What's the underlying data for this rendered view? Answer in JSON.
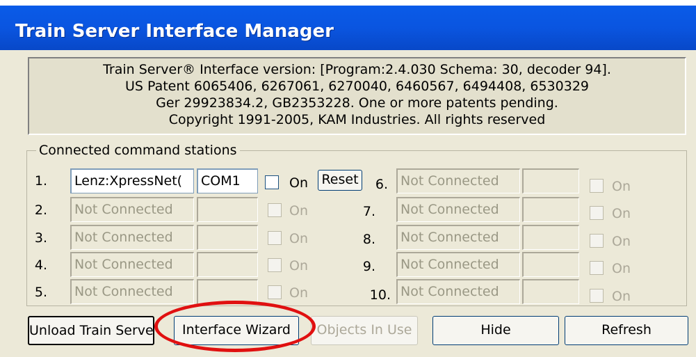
{
  "window": {
    "title": "Train Server Interface Manager"
  },
  "info": {
    "lines": [
      "Train Server® Interface version: [Program:2.4.030 Schema: 30, decoder 94].",
      "US Patent  6065406, 6267061, 6270040, 6460567, 6494408, 6530329",
      "Ger 29923834.2, GB2353228. One or more patents pending.",
      "Copyright 1991-2005, KAM Industries. All rights reserved"
    ]
  },
  "stations": {
    "group_label": "Connected command stations",
    "reset_label": "Reset",
    "on_label": "On",
    "left": [
      {
        "num": "1.",
        "name": "Lenz:XpressNet(",
        "port": "COM1"
      },
      {
        "num": "2.",
        "name": "Not Connected",
        "port": ""
      },
      {
        "num": "3.",
        "name": "Not Connected",
        "port": ""
      },
      {
        "num": "4.",
        "name": "Not Connected",
        "port": ""
      },
      {
        "num": "5.",
        "name": "Not Connected",
        "port": ""
      }
    ],
    "right": [
      {
        "num": "6.",
        "name": "Not Connected",
        "port": ""
      },
      {
        "num": "7.",
        "name": "Not Connected",
        "port": ""
      },
      {
        "num": "8.",
        "name": "Not Connected",
        "port": ""
      },
      {
        "num": "9.",
        "name": "Not Connected",
        "port": ""
      },
      {
        "num": "10.",
        "name": "Not Connected",
        "port": ""
      }
    ]
  },
  "buttons": {
    "unload": "Unload Train Server",
    "wizard": "Interface Wizard",
    "objects": "Objects In Use",
    "hide": "Hide",
    "refresh": "Refresh"
  },
  "colors": {
    "titlebar": "#0a55e0",
    "highlight_oval": "#e01010",
    "dialog_bg": "#ece9d8"
  }
}
